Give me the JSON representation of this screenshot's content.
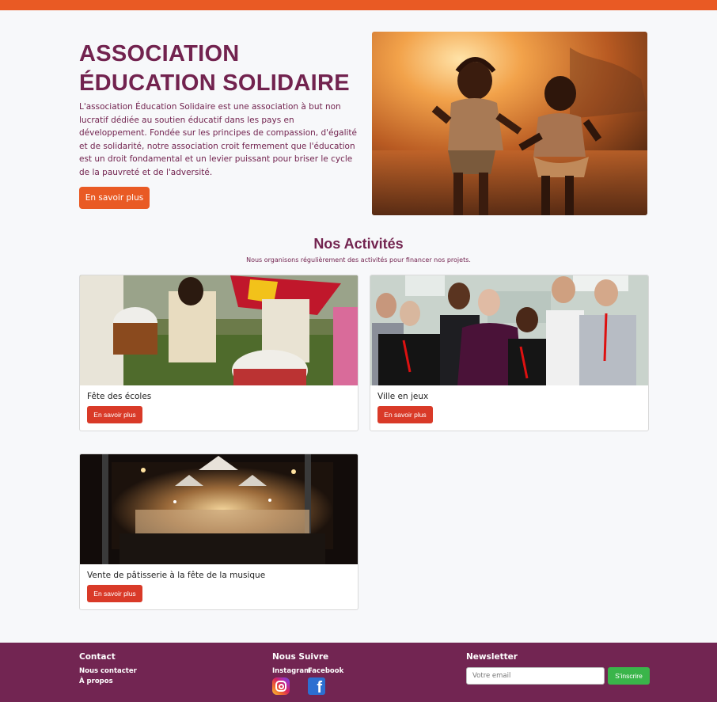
{
  "hero": {
    "title_line1": "ASSOCIATION",
    "title_line2": "ÉDUCATION SOLIDAIRE",
    "description": "L'association Éducation Solidaire est une association à but non lucratif dédiée au soutien éducatif dans les pays en développement. Fondée sur les principes de compassion, d'égalité et de solidarité, notre association croit fermement que l'éducation est un droit fondamental et un levier puissant pour briser le cycle de la pauvreté et de l'adversité.",
    "button_label": "En savoir plus"
  },
  "activities": {
    "title": "Nos Activités",
    "subtitle": "Nous organisons régulièrement des activités pour financer nos projets.",
    "cards": [
      {
        "title": "Fête des écoles",
        "button_label": "En savoir plus"
      },
      {
        "title": "Ville en jeux",
        "button_label": "En savoir plus"
      },
      {
        "title": "Vente de pâtisserie à la fête de la musique",
        "button_label": "En savoir plus"
      }
    ]
  },
  "footer": {
    "contact": {
      "heading": "Contact",
      "links": [
        "Nous contacter",
        "À propos"
      ]
    },
    "follow": {
      "heading": "Nous Suivre",
      "links": [
        "Instagram",
        "Facebook"
      ]
    },
    "newsletter": {
      "heading": "Newsletter",
      "placeholder": "Votre email",
      "button_label": "S'inscrire"
    }
  },
  "colors": {
    "accent_orange": "#e95a24",
    "brand_purple": "#722552",
    "card_button_red": "#d93a28",
    "newsletter_green": "#3ab54a"
  }
}
